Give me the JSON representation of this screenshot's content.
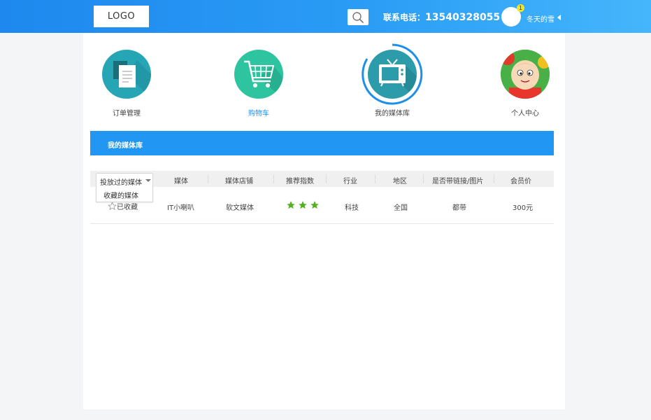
{
  "header": {
    "logo": "LOGO",
    "phone_label": "联系电话：",
    "phone_number": "13540328055",
    "notification_count": "1",
    "username": "冬天的雪"
  },
  "nav": {
    "items": [
      {
        "label": "订单管理",
        "icon": "order-document-icon",
        "active": false
      },
      {
        "label": "购物车",
        "icon": "shopping-cart-icon",
        "active": true
      },
      {
        "label": "我的媒体库",
        "icon": "tv-media-icon",
        "active": false
      },
      {
        "label": "个人中心",
        "icon": "cartoon-avatar",
        "active": false
      }
    ]
  },
  "banner": {
    "title": "我的媒体库"
  },
  "filter": {
    "selected": "投放过的媒体",
    "options": [
      "收藏的媒体"
    ]
  },
  "table": {
    "headers": [
      "媒体",
      "媒体店铺",
      "推荐指数",
      "行业",
      "地区",
      "是否带链接/图片",
      "会员价"
    ],
    "rows": [
      {
        "favorite": "已收藏",
        "media": "IT小喇叭",
        "shop": "软文媒体",
        "stars": 3,
        "industry": "科技",
        "region": "全国",
        "link": "都带",
        "price": "300元"
      }
    ]
  },
  "colors": {
    "accent": "#2196f3",
    "header_start": "#1e88ee",
    "header_end": "#45b6fb",
    "star": "#52b11f",
    "active_nav": "#1e90ff"
  }
}
